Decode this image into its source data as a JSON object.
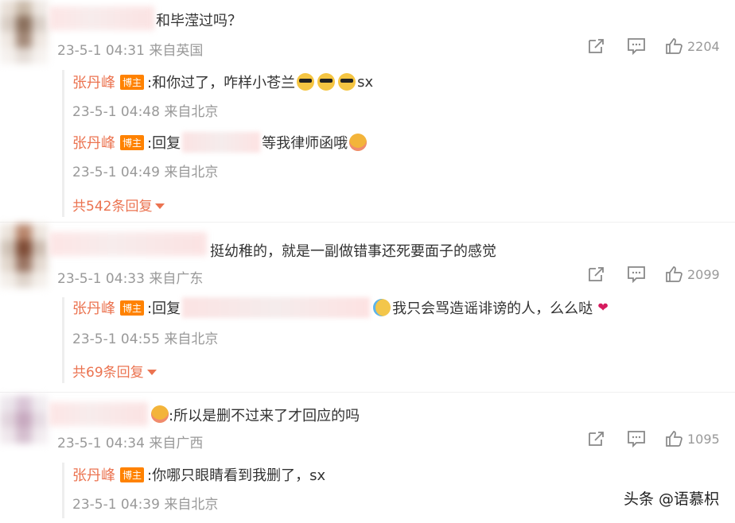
{
  "comments": [
    {
      "text": "和毕滢过吗？",
      "time": "23-5-1 04:31",
      "location": "来自英国",
      "likes": "2204",
      "replies": [
        {
          "author": "张丹峰",
          "badge": "博主",
          "prefix": ":和你过了，咋样小苍兰",
          "suffix": "sx",
          "time": "23-5-1 04:48",
          "location": "来自北京"
        },
        {
          "author": "张丹峰",
          "badge": "博主",
          "prefix": ":回复",
          "suffix": "等我律师函哦",
          "time": "23-5-1 04:49",
          "location": "来自北京"
        }
      ],
      "more": "共542条回复"
    },
    {
      "text": "挺幼稚的，就是一副做错事还死要面子的感觉",
      "time": "23-5-1 04:33",
      "location": "来自广东",
      "likes": "2099",
      "replies": [
        {
          "author": "张丹峰",
          "badge": "博主",
          "prefix": ":回复",
          "suffix": "我只会骂造谣诽谤的人，么么哒",
          "time": "23-5-1 04:55",
          "location": "来自北京"
        }
      ],
      "more": "共69条回复"
    },
    {
      "text": ":所以是删不过来了才回应的吗",
      "time": "23-5-1 04:34",
      "location": "来自广西",
      "likes": "1095",
      "replies": [
        {
          "author": "张丹峰",
          "badge": "博主",
          "prefix": ":你哪只眼睛看到我删了，sx",
          "suffix": "",
          "time": "23-5-1 04:39",
          "location": "来自北京"
        }
      ]
    }
  ],
  "icons": [
    "share-icon",
    "comment-icon",
    "like-icon"
  ],
  "colors": {
    "author": "#eb7350",
    "badge": "#ff8200",
    "meta": "#999999"
  },
  "watermark": "头条 @语慕枳"
}
